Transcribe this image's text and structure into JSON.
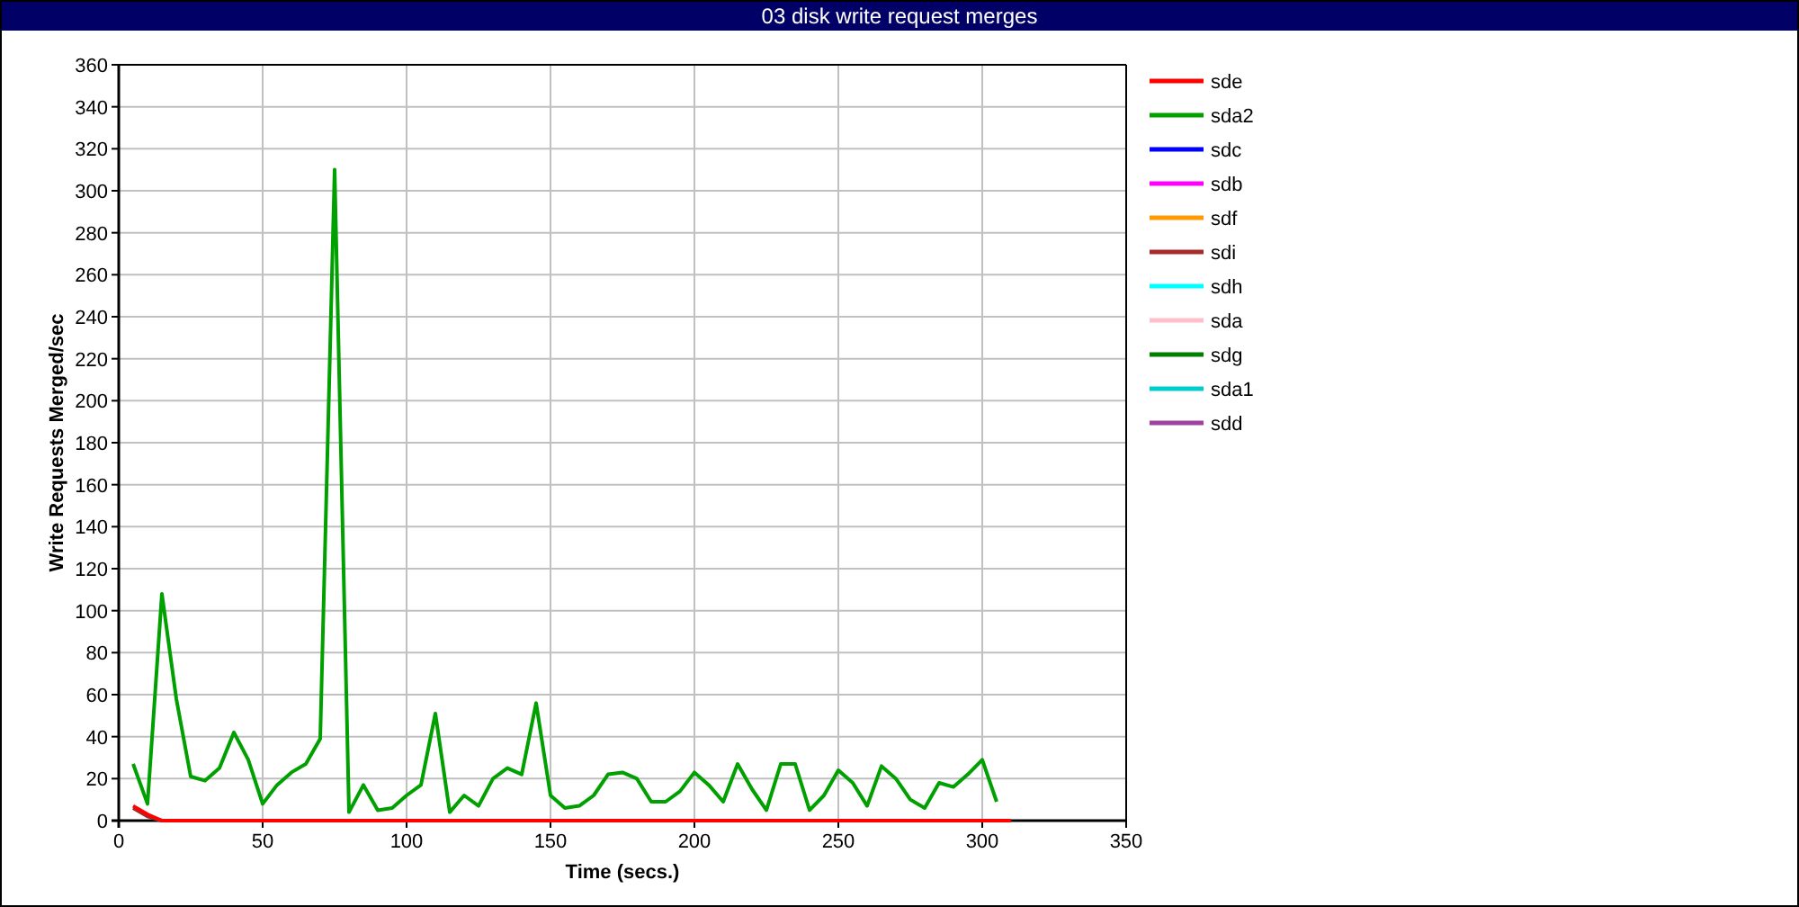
{
  "chart_data": {
    "type": "line",
    "grid": true,
    "legend": "right",
    "title": "03 disk write request merges",
    "xlabel": "Time (secs.)",
    "ylabel": "Write Requests Merged/sec",
    "xlim": [
      0,
      350
    ],
    "ylim": [
      0,
      360
    ],
    "xticks": [
      0,
      50,
      100,
      150,
      200,
      250,
      300,
      350
    ],
    "yticks": [
      0,
      20,
      40,
      60,
      80,
      100,
      120,
      140,
      160,
      180,
      200,
      220,
      240,
      260,
      280,
      300,
      320,
      340,
      360
    ],
    "x": [
      5,
      10,
      15,
      20,
      25,
      30,
      35,
      40,
      45,
      50,
      55,
      60,
      65,
      70,
      75,
      80,
      85,
      90,
      95,
      100,
      105,
      110,
      115,
      120,
      125,
      130,
      135,
      140,
      145,
      150,
      155,
      160,
      165,
      170,
      175,
      180,
      185,
      190,
      195,
      200,
      205,
      210,
      215,
      220,
      225,
      230,
      235,
      240,
      245,
      250,
      255,
      260,
      265,
      270,
      275,
      280,
      285,
      290,
      295,
      300,
      305,
      310
    ],
    "series": [
      {
        "name": "sde",
        "color": "#ff0000",
        "values": [
          7,
          3,
          0,
          0,
          0,
          0,
          0,
          0,
          0,
          0,
          0,
          0,
          0,
          0,
          0,
          0,
          0,
          0,
          0,
          0,
          0,
          0,
          0,
          0,
          0,
          0,
          0,
          0,
          0,
          0,
          0,
          0,
          0,
          0,
          0,
          0,
          0,
          0,
          0,
          0,
          0,
          0,
          0,
          0,
          0,
          0,
          0,
          0,
          0,
          0,
          0,
          0,
          0,
          0,
          0,
          0,
          0,
          0,
          0,
          0,
          0,
          0
        ]
      },
      {
        "name": "sda2",
        "color": "#00a000",
        "values": [
          27,
          8,
          108,
          58,
          21,
          19,
          25,
          42,
          29,
          8,
          17,
          23,
          27,
          39,
          310,
          4,
          17,
          5,
          6,
          12,
          17,
          51,
          4,
          12,
          7,
          20,
          25,
          22,
          56,
          12,
          6,
          7,
          12,
          22,
          23,
          20,
          9,
          9,
          14,
          23,
          17,
          9,
          27,
          15,
          5,
          27,
          27,
          5,
          12,
          24,
          18,
          7,
          26,
          20,
          10,
          6,
          18,
          16,
          22,
          29,
          9,
          null
        ]
      },
      {
        "name": "sdc",
        "color": "#0000ff",
        "values": [
          null,
          null,
          null,
          null,
          null,
          null,
          null,
          null,
          null,
          null,
          null,
          null,
          null,
          null,
          null,
          null,
          null,
          null,
          null,
          null,
          null,
          null,
          null,
          null,
          null,
          null,
          null,
          null,
          null,
          null,
          null,
          null,
          null,
          null,
          null,
          null,
          null,
          null,
          null,
          null,
          null,
          null,
          null,
          null,
          null,
          null,
          null,
          null,
          null,
          null,
          null,
          null,
          null,
          null,
          null,
          null,
          null,
          null,
          null,
          null,
          null,
          null
        ]
      },
      {
        "name": "sdb",
        "color": "#ff00ff",
        "values": [
          null,
          null,
          null,
          null,
          null,
          null,
          null,
          null,
          null,
          null,
          null,
          null,
          null,
          null,
          null,
          null,
          null,
          null,
          null,
          null,
          null,
          null,
          null,
          null,
          null,
          null,
          null,
          null,
          null,
          null,
          null,
          null,
          null,
          null,
          null,
          null,
          null,
          null,
          null,
          null,
          null,
          null,
          null,
          null,
          null,
          null,
          null,
          null,
          null,
          null,
          null,
          null,
          null,
          null,
          null,
          null,
          null,
          null,
          null,
          null,
          null,
          null
        ]
      },
      {
        "name": "sdf",
        "color": "#ff9900",
        "values": [
          null,
          null,
          null,
          null,
          null,
          null,
          null,
          null,
          null,
          null,
          null,
          null,
          null,
          null,
          null,
          null,
          null,
          null,
          null,
          null,
          null,
          null,
          null,
          null,
          null,
          null,
          null,
          null,
          null,
          null,
          null,
          null,
          null,
          null,
          null,
          null,
          null,
          null,
          null,
          null,
          null,
          null,
          null,
          null,
          null,
          null,
          null,
          null,
          null,
          null,
          null,
          null,
          null,
          null,
          null,
          null,
          null,
          null,
          null,
          null,
          null,
          null
        ]
      },
      {
        "name": "sdi",
        "color": "#a52a2a",
        "values": [
          6,
          2,
          0,
          null,
          null,
          null,
          null,
          null,
          null,
          null,
          null,
          null,
          null,
          null,
          null,
          null,
          null,
          null,
          null,
          null,
          null,
          null,
          null,
          null,
          null,
          null,
          null,
          null,
          null,
          null,
          null,
          null,
          null,
          null,
          null,
          null,
          null,
          null,
          null,
          null,
          null,
          null,
          null,
          null,
          null,
          null,
          null,
          null,
          null,
          null,
          null,
          null,
          null,
          null,
          null,
          null,
          null,
          null,
          null,
          null,
          null,
          null
        ]
      },
      {
        "name": "sdh",
        "color": "#00ffff",
        "values": [
          null,
          null,
          null,
          null,
          null,
          null,
          null,
          null,
          null,
          null,
          null,
          null,
          null,
          null,
          null,
          null,
          null,
          null,
          null,
          null,
          null,
          null,
          null,
          null,
          null,
          null,
          null,
          null,
          null,
          null,
          null,
          null,
          null,
          null,
          null,
          null,
          null,
          null,
          null,
          null,
          null,
          null,
          null,
          null,
          null,
          null,
          null,
          null,
          null,
          null,
          null,
          null,
          null,
          null,
          null,
          null,
          null,
          null,
          null,
          null,
          null,
          null
        ]
      },
      {
        "name": "sda",
        "color": "#ffc0cb",
        "values": [
          null,
          null,
          null,
          null,
          null,
          null,
          null,
          null,
          null,
          null,
          null,
          null,
          null,
          null,
          null,
          null,
          null,
          null,
          null,
          null,
          null,
          null,
          null,
          null,
          null,
          null,
          null,
          null,
          null,
          null,
          null,
          null,
          null,
          null,
          null,
          null,
          null,
          null,
          null,
          null,
          null,
          null,
          null,
          null,
          null,
          null,
          null,
          null,
          null,
          null,
          null,
          null,
          null,
          null,
          null,
          null,
          null,
          null,
          null,
          null,
          null,
          null
        ]
      },
      {
        "name": "sdg",
        "color": "#008000",
        "values": [
          null,
          null,
          null,
          null,
          null,
          null,
          null,
          null,
          null,
          null,
          null,
          null,
          null,
          null,
          null,
          null,
          null,
          null,
          null,
          null,
          null,
          null,
          null,
          null,
          null,
          null,
          null,
          null,
          null,
          null,
          null,
          null,
          null,
          null,
          null,
          null,
          null,
          null,
          null,
          null,
          null,
          null,
          null,
          null,
          null,
          null,
          null,
          null,
          null,
          null,
          null,
          null,
          null,
          null,
          null,
          null,
          null,
          null,
          null,
          null,
          null,
          null
        ]
      },
      {
        "name": "sda1",
        "color": "#00cccc",
        "values": [
          null,
          null,
          null,
          null,
          null,
          null,
          null,
          null,
          null,
          null,
          null,
          null,
          null,
          null,
          null,
          null,
          null,
          null,
          null,
          null,
          null,
          null,
          null,
          null,
          null,
          null,
          null,
          null,
          null,
          null,
          null,
          null,
          null,
          null,
          null,
          null,
          null,
          null,
          null,
          null,
          null,
          null,
          null,
          null,
          null,
          null,
          null,
          null,
          null,
          null,
          null,
          null,
          null,
          null,
          null,
          null,
          null,
          null,
          null,
          null,
          null,
          null
        ]
      },
      {
        "name": "sdd",
        "color": "#a040a0",
        "values": [
          null,
          null,
          null,
          null,
          null,
          null,
          null,
          null,
          null,
          null,
          null,
          null,
          null,
          null,
          null,
          null,
          null,
          null,
          null,
          null,
          null,
          null,
          null,
          null,
          null,
          null,
          null,
          null,
          null,
          null,
          null,
          null,
          null,
          null,
          null,
          null,
          null,
          null,
          null,
          null,
          null,
          null,
          null,
          null,
          null,
          null,
          null,
          null,
          null,
          null,
          null,
          null,
          null,
          null,
          null,
          null,
          null,
          null,
          null,
          null,
          null,
          null
        ]
      }
    ]
  }
}
